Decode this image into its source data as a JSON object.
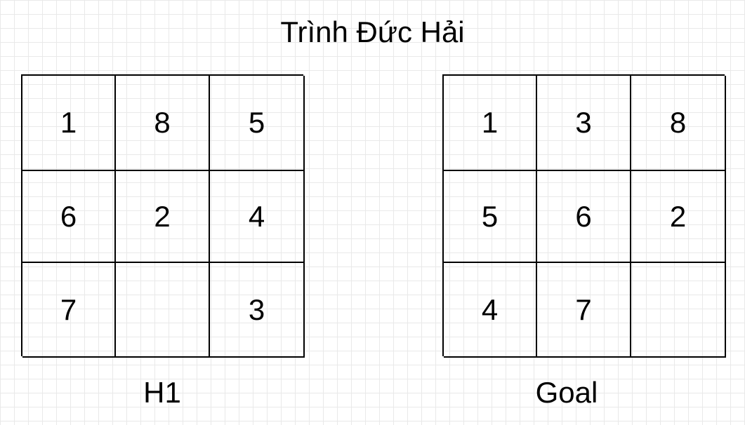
{
  "title": "Trình Đức Hải",
  "puzzles": [
    {
      "caption": "H1",
      "cells": [
        "1",
        "8",
        "5",
        "6",
        "2",
        "4",
        "7",
        "",
        "3"
      ]
    },
    {
      "caption": "Goal",
      "cells": [
        "1",
        "3",
        "8",
        "5",
        "6",
        "2",
        "4",
        "7",
        ""
      ]
    }
  ]
}
